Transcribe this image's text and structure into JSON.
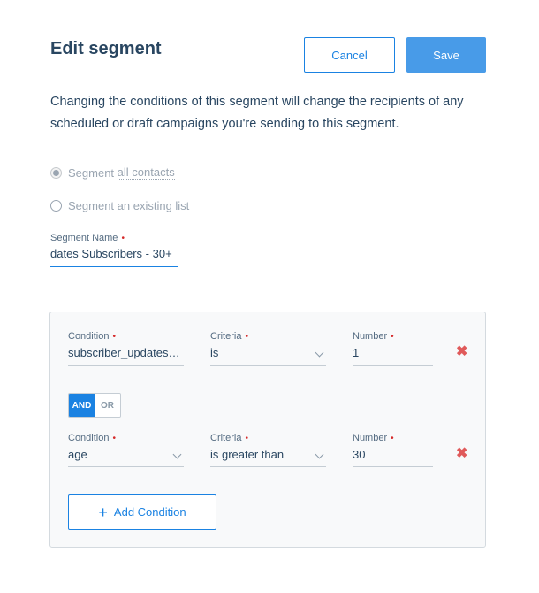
{
  "header": {
    "title": "Edit segment",
    "cancel_label": "Cancel",
    "save_label": "Save"
  },
  "description": "Changing the conditions of this segment will change the recipients of any scheduled or draft campaigns you're sending to this segment.",
  "segment_options": {
    "all_contacts_prefix": "Segment",
    "all_contacts_link": "all contacts",
    "existing_list": "Segment an existing list",
    "selected": "all contacts"
  },
  "segment_name": {
    "label": "Segment Name",
    "required_mark": "•",
    "value": "dates Subscribers - 30+"
  },
  "conditions": {
    "condition_label": "Condition",
    "criteria_label": "Criteria",
    "number_label": "Number",
    "required_mark": "•",
    "rows": [
      {
        "condition": "subscriber_updates…",
        "criteria": "is",
        "number": "1"
      },
      {
        "condition": "age",
        "criteria": "is greater than",
        "number": "30"
      }
    ],
    "and_label": "AND",
    "or_label": "OR",
    "delete_icon": "✖",
    "add_label": "Add Condition",
    "add_icon": "+"
  },
  "colors": {
    "accent": "#1a82e2",
    "save_button": "#489be8",
    "required": "#d52a2a",
    "delete": "#e05a5a"
  }
}
